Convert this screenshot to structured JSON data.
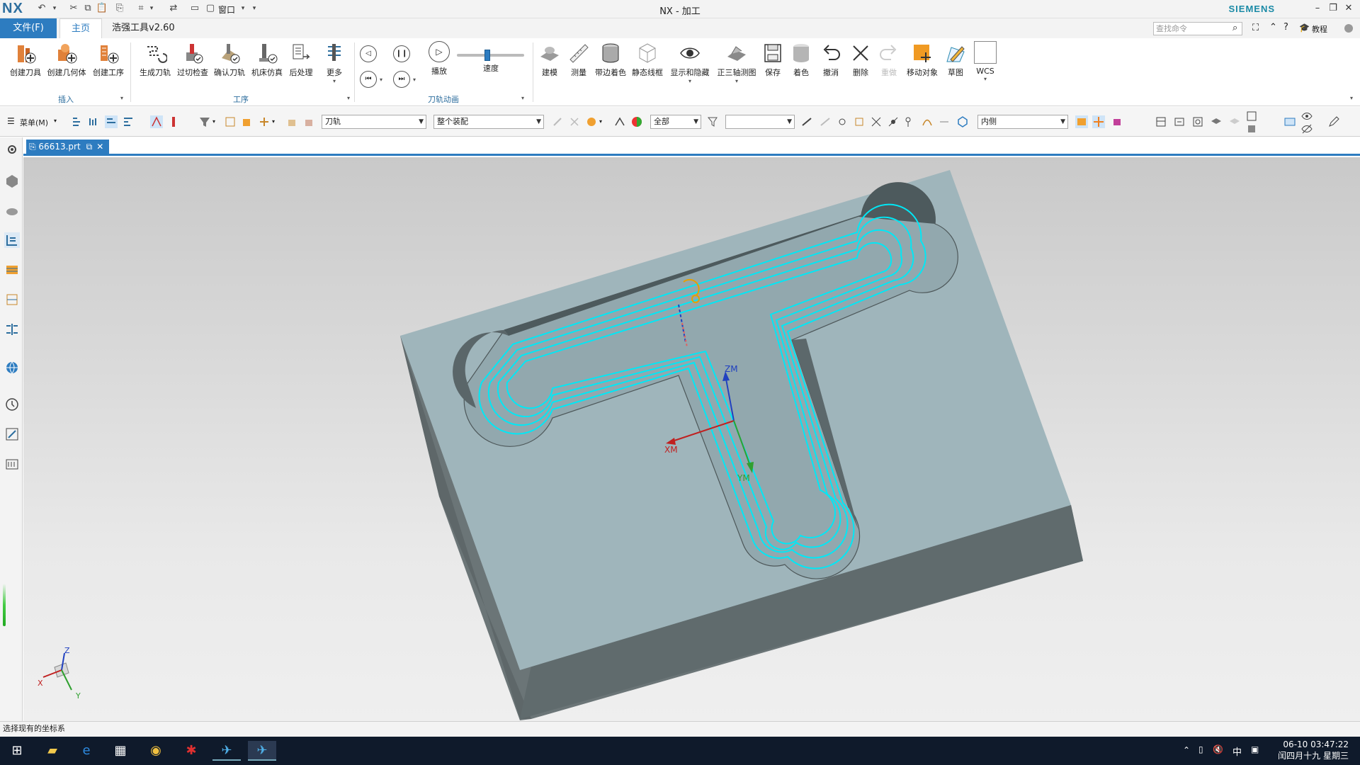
{
  "app": {
    "logo": "NX",
    "window_title": "NX - 加工",
    "brand": "SIEMENS",
    "quick_access_window_label": "窗口"
  },
  "tabs": {
    "file": "文件(F)",
    "home": "主页",
    "tools": "浩强工具v2.60"
  },
  "search": {
    "placeholder": "查找命令"
  },
  "help_label": "教程",
  "ribbon": {
    "insert": {
      "label": "插入",
      "buttons": [
        "创建刀具",
        "创建几何体",
        "创建工序"
      ]
    },
    "operation": {
      "label": "工序",
      "buttons": [
        "生成刀轨",
        "过切检查",
        "确认刀轨",
        "机床仿真",
        "后处理",
        "更多"
      ]
    },
    "animation": {
      "label": "刀轨动画",
      "play": "播放",
      "speed": "速度",
      "speed_level": 0.45
    },
    "view": {
      "buttons": [
        "建模",
        "测量",
        "带边着色",
        "静态线框",
        "显示和隐藏",
        "正三轴测图",
        "保存",
        "着色",
        "撤消",
        "删除",
        "重做",
        "移动对象",
        "草图",
        "WCS"
      ]
    }
  },
  "toolbar2": {
    "menu_label": "菜单(M)",
    "filter_type": "刀轨",
    "scope": "整个装配",
    "layer_select": "全部",
    "blank_select": "",
    "selection_intent": "内侧"
  },
  "document": {
    "tab_label": "66613.prt"
  },
  "viewport": {
    "csys": {
      "z": "ZM",
      "x": "XM",
      "y": "YM"
    },
    "triad": {
      "z": "Z",
      "x": "X",
      "y": "Y"
    }
  },
  "status": {
    "prompt": "选择现有的坐标系"
  },
  "taskbar": {
    "ime": "中",
    "time": "06-10 03:47:22",
    "date": "闰四月十九 星期三"
  },
  "colors": {
    "accent": "#2d7cc0",
    "toolpath": "#00f0ff",
    "part_top": "#9fb6bd",
    "part_side": "#5f6d70"
  }
}
